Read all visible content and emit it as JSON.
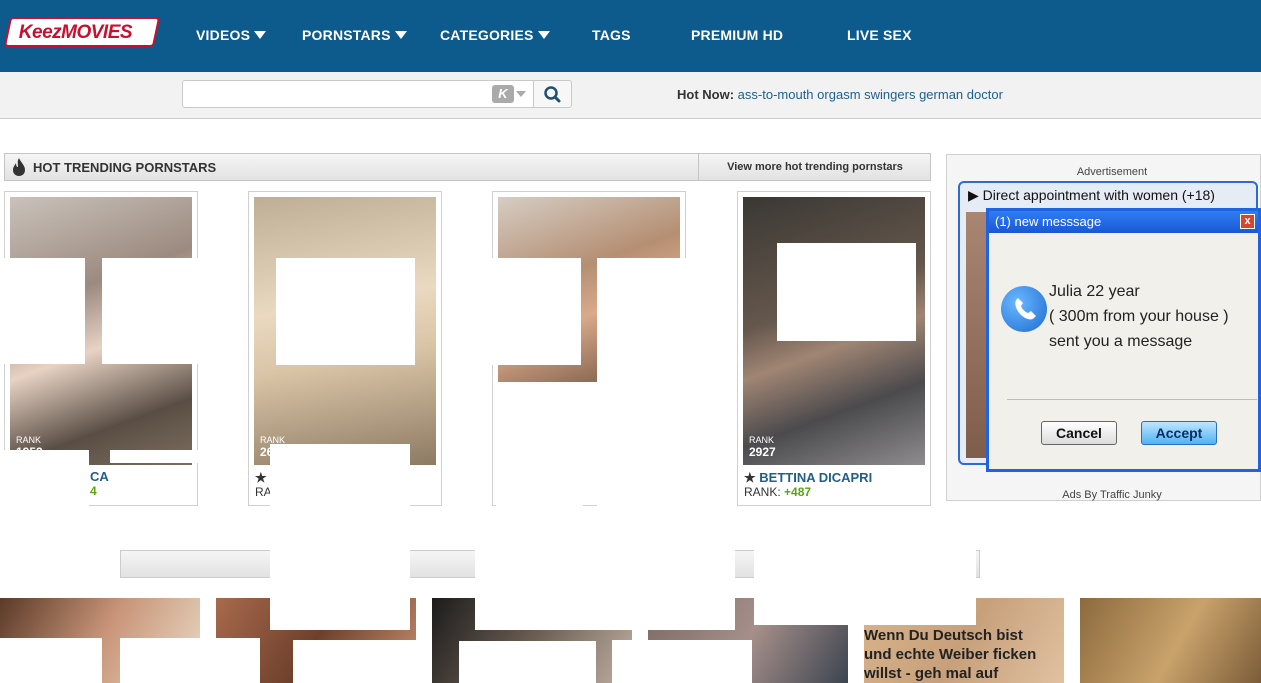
{
  "logo": {
    "text": "KeezMOVIES"
  },
  "nav": [
    {
      "label": "VIDEOS",
      "has_caret": true
    },
    {
      "label": "PORNSTARS",
      "has_caret": true
    },
    {
      "label": "CATEGORIES",
      "has_caret": true
    },
    {
      "label": "TAGS",
      "has_caret": false
    },
    {
      "label": "PREMIUM HD",
      "has_caret": false
    },
    {
      "label": "LIVE SEX",
      "has_caret": false
    }
  ],
  "search": {
    "value": "",
    "k_label": "K"
  },
  "hot_now": {
    "label": "Hot Now:",
    "links": [
      "ass-to-mouth",
      "orgasm",
      "swingers",
      "german",
      "doctor"
    ]
  },
  "section": {
    "title": "HOT TRENDING PORNSTARS",
    "view_more": "View more hot trending pornstars"
  },
  "pornstars": [
    {
      "rank_label": "RANK",
      "rank": "1952",
      "name": "CA",
      "rank_change": "4"
    },
    {
      "rank_label": "RANK",
      "rank": "26",
      "name": "",
      "rank_change": ""
    },
    {
      "rank_label": "",
      "rank": "",
      "name": "",
      "rank_change": ""
    },
    {
      "rank_label": "RANK",
      "rank": "2927",
      "name": "BETTINA DICAPRI",
      "rank_change": "+487"
    }
  ],
  "card_rank_prefix": "RANK:",
  "card_rank_prefix_partial": "RA",
  "ad": {
    "label": "Advertisement",
    "title": "Direct appointment with women (+18)",
    "footer": "Ads By Traffic Junky",
    "popup": {
      "title": "(1) new messsage",
      "close": "x",
      "lines": [
        "Julia 22 year",
        "( 300m from your house )",
        "sent you a message"
      ],
      "cancel": "Cancel",
      "accept": "Accept"
    }
  },
  "video_thumb_text": [
    "Wenn Du Deutsch bist",
    "und echte Weiber ficken",
    "willst - geh mal auf"
  ],
  "colors": {
    "header": "#0d5a8c",
    "link": "#1f5f8b",
    "rank_up": "#5aa313",
    "popup_blue": "#1f63e0"
  }
}
